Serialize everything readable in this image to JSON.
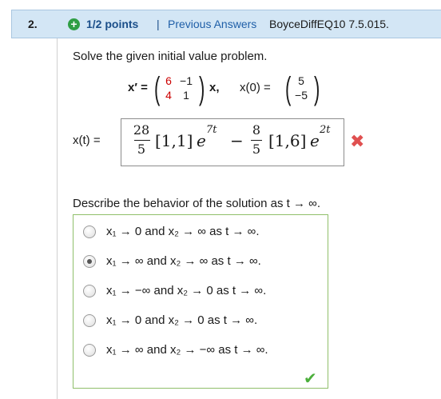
{
  "header": {
    "question_number": "2.",
    "points": "1/2 points",
    "separator": "|",
    "previous_answers": "Previous Answers",
    "code": "BoyceDiffEQ10 7.5.015."
  },
  "prompt": "Solve the given initial value problem.",
  "system": {
    "lhs": "x′ =",
    "matrix": [
      "6",
      "−1",
      "4",
      "1"
    ],
    "x_label": "x,",
    "ic_label": "x(0) =",
    "ic": [
      "5",
      "−5"
    ]
  },
  "answer": {
    "label": "x(t) =",
    "term1_num": "28",
    "term1_den": "5",
    "term1_vec": "[1,1]",
    "term1_base": "e",
    "term1_exp": "7t",
    "minus": "−",
    "term2_num": "8",
    "term2_den": "5",
    "term2_vec": "[1,6]",
    "term2_base": "e",
    "term2_exp": "2t",
    "incorrect_mark": "✖"
  },
  "describe": "Describe the behavior of the solution as  t → ∞.",
  "options": [
    {
      "text": "x₁ → 0 and x₂ → ∞ as t → ∞.",
      "selected": false
    },
    {
      "text": "x₁ → ∞ and x₂ → ∞ as t → ∞.",
      "selected": true
    },
    {
      "text": "x₁ → −∞ and x₂ → 0 as t → ∞.",
      "selected": false
    },
    {
      "text": "x₁ → 0 and x₂ → 0 as t → ∞.",
      "selected": false
    },
    {
      "text": "x₁ → ∞ and x₂ → −∞ as t → ∞.",
      "selected": false
    }
  ],
  "correct_mark": "✔",
  "colors": {
    "header_bg": "#d3e6f5",
    "link": "#1f5fa8",
    "red": "#cc0000",
    "correct": "#4caf3c",
    "incorrect": "#e05050"
  }
}
